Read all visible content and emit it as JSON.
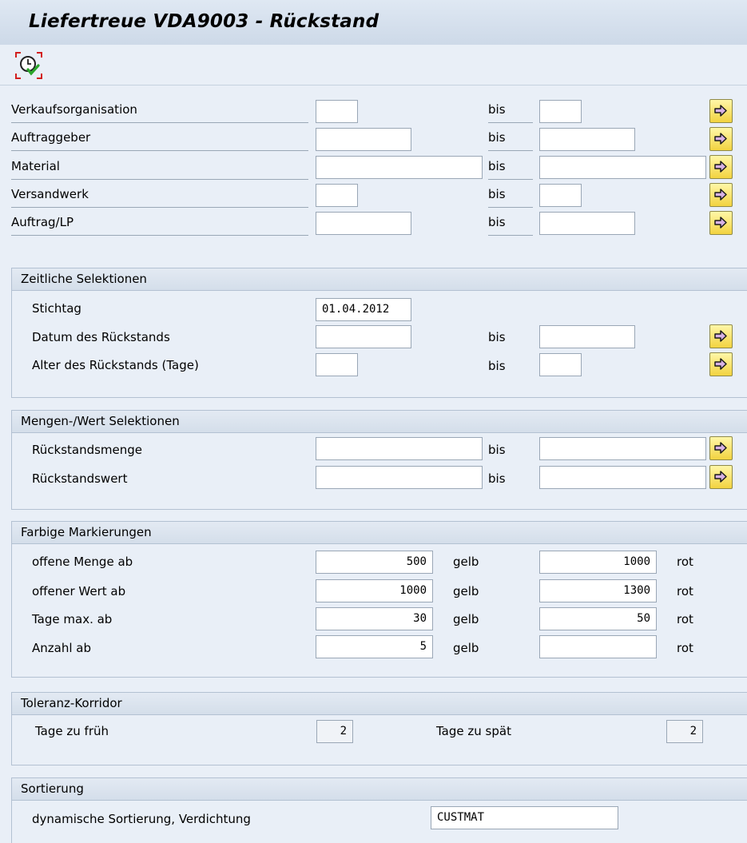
{
  "title": "Liefertreue VDA9003 - Rückstand",
  "range_rows": [
    {
      "label": "Verkaufsorganisation",
      "bis": "bis",
      "from": "",
      "to": ""
    },
    {
      "label": "Auftraggeber",
      "bis": "bis",
      "from": "",
      "to": ""
    },
    {
      "label": "Material",
      "bis": "bis",
      "from": "",
      "to": ""
    },
    {
      "label": "Versandwerk",
      "bis": "bis",
      "from": "",
      "to": ""
    },
    {
      "label": "Auftrag/LP",
      "bis": "bis",
      "from": "",
      "to": ""
    }
  ],
  "zeitliche": {
    "title": "Zeitliche Selektionen",
    "stichtag_label": "Stichtag",
    "stichtag_value": "01.04.2012",
    "datum_label": "Datum des Rückstands",
    "datum_bis": "bis",
    "alter_label": "Alter des Rückstands (Tage)",
    "alter_bis": "bis"
  },
  "mengen": {
    "title": "Mengen-/Wert Selektionen",
    "menge_label": "Rückstandsmenge",
    "menge_bis": "bis",
    "wert_label": "Rückstandswert",
    "wert_bis": "bis"
  },
  "farbige": {
    "title": "Farbige Markierungen",
    "rows": [
      {
        "label": "offene Menge ab",
        "gelb_value": "500",
        "gelb": "gelb",
        "rot_value": "1000",
        "rot": "rot"
      },
      {
        "label": "offener Wert ab",
        "gelb_value": "1000",
        "gelb": "gelb",
        "rot_value": "1300",
        "rot": "rot"
      },
      {
        "label": "Tage max. ab",
        "gelb_value": "30",
        "gelb": "gelb",
        "rot_value": "50",
        "rot": "rot"
      },
      {
        "label": "Anzahl ab",
        "gelb_value": "5",
        "gelb": "gelb",
        "rot_value": "",
        "rot": "rot"
      }
    ]
  },
  "toleranz": {
    "title": "Toleranz-Korridor",
    "frueh_label": "Tage zu früh",
    "frueh_value": "2",
    "spaet_label": "Tage zu spät",
    "spaet_value": "2"
  },
  "sortierung": {
    "title": "Sortierung",
    "label": "dynamische Sortierung, Verdichtung",
    "value": "CUSTMAT"
  },
  "icons": {
    "execute": "execute-clock-icon",
    "multiple_selection": "multiple-selection-arrow-icon"
  },
  "colors": {
    "background": "#e9eff7",
    "arrow_button": "#f2d340",
    "field_border": "#9aa7b6"
  }
}
